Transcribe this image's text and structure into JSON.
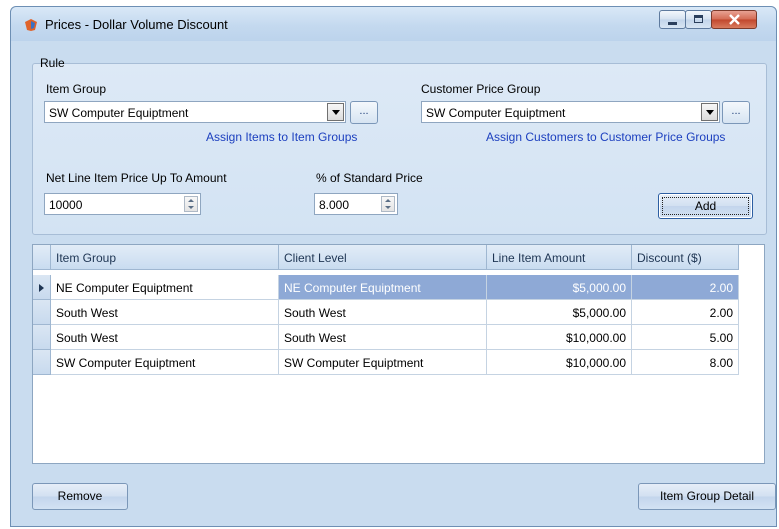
{
  "window": {
    "title": "Prices - Dollar Volume Discount"
  },
  "rule": {
    "legend": "Rule",
    "item_group_label": "Item Group",
    "item_group_value": "SW Computer Equiptment",
    "assign_items_link": "Assign Items to Item Groups",
    "customer_price_group_label": "Customer Price Group",
    "customer_price_group_value": "SW Computer Equiptment",
    "assign_customers_link": "Assign Customers to Customer Price Groups",
    "ellipsis_label": "...",
    "net_line_label": "Net Line Item Price Up To Amount",
    "net_line_value": "10000",
    "pct_label": "% of Standard Price",
    "pct_value": "8.000",
    "add_label": "Add"
  },
  "grid": {
    "columns": [
      "Item Group",
      "Client Level",
      "Line Item Amount",
      "Discount ($)"
    ],
    "rows": [
      [
        "NE Computer Equiptment",
        "NE Computer Equiptment",
        "$5,000.00",
        "2.00"
      ],
      [
        "South West",
        "South West",
        "$5,000.00",
        "2.00"
      ],
      [
        "South West",
        "South West",
        "$10,000.00",
        "5.00"
      ],
      [
        "SW Computer Equiptment",
        "SW Computer Equiptment",
        "$10,000.00",
        "8.00"
      ]
    ],
    "selected_row": 0
  },
  "footer": {
    "remove_label": "Remove",
    "item_group_detail_label": "Item Group Detail"
  },
  "colors": {
    "selection": "#8ea9d6",
    "link": "#1c3fbf"
  }
}
